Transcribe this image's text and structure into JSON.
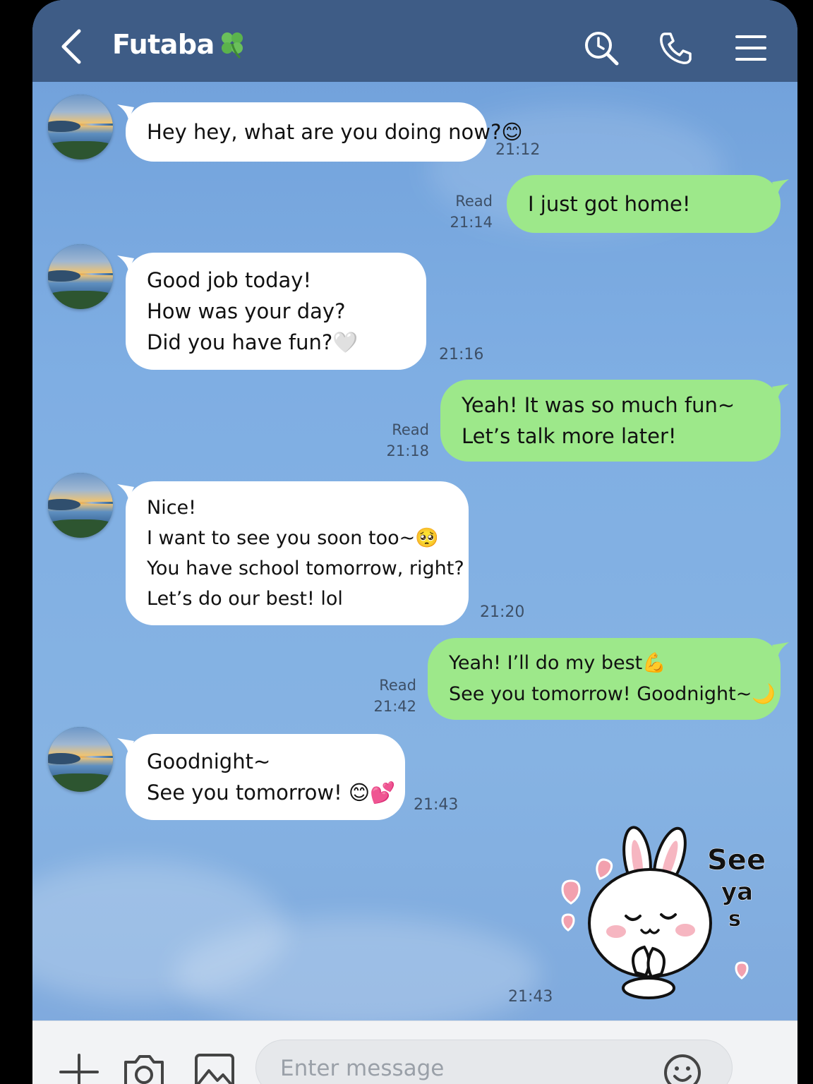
{
  "header": {
    "title": "Futaba",
    "title_suffix_icon": "clover-icon",
    "background": "#3e5c86",
    "icons": [
      "back-icon",
      "search-icon",
      "phone-icon",
      "menu-icon"
    ]
  },
  "messages": [
    {
      "direction": "in",
      "lines": [
        "Hey hey, what are you doing now?😊"
      ],
      "time": "21:12"
    },
    {
      "direction": "out",
      "lines": [
        "I just got home!"
      ],
      "status": "Read",
      "time": "21:14"
    },
    {
      "direction": "in",
      "lines": [
        "Good job today!",
        "How was your day?",
        "Did you have fun?🤍"
      ],
      "time": "21:16"
    },
    {
      "direction": "out",
      "lines": [
        "Yeah! It was so much fun~",
        "Let’s talk more later!"
      ],
      "status": "Read",
      "time": "21:18"
    },
    {
      "direction": "in",
      "lines": [
        "Nice!",
        "I want to see you soon too~🥺",
        "You have school tomorrow, right?",
        "Let’s do our best! lol"
      ],
      "time": "21:20"
    },
    {
      "direction": "out",
      "lines": [
        "Yeah! I’ll do my best💪",
        "See you tomorrow! Goodnight~🌙"
      ],
      "status": "Read",
      "time": "21:42"
    },
    {
      "direction": "in",
      "lines": [
        "Goodnight~",
        "See you tomorrow! 😊💕"
      ],
      "time": "21:43"
    }
  ],
  "sticker": {
    "icon": "bunny-sticker-icon",
    "text_lines": [
      "See",
      "ya",
      "s"
    ],
    "time": "21:43"
  },
  "input_bar": {
    "placeholder": "Enter message",
    "icons": [
      "plus-icon",
      "camera-icon",
      "image-icon",
      "emoji-icon"
    ]
  },
  "colors": {
    "incoming_bubble": "#ffffff",
    "outgoing_bubble": "#9de88a",
    "chat_background": "#7faee3"
  }
}
